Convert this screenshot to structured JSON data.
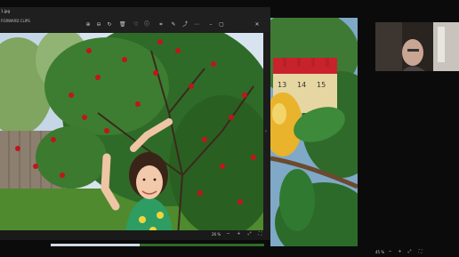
{
  "viewer_left": {
    "title": "1.jpg",
    "breadcrumb": "FORWARD CLIPS",
    "zoom": "26 %",
    "toolbar_icons": [
      "zoom-in-icon",
      "zoom-out-icon",
      "rotate-icon",
      "delete-icon",
      "favorite-icon",
      "info-icon",
      "crop-icon",
      "edit-icon",
      "share-icon",
      "more-icon",
      "minimize-icon",
      "maximize-icon",
      "close-icon"
    ]
  },
  "status_right": {
    "zoom": "45 %"
  },
  "colors": {
    "window_bg": "#1c1c1c",
    "leaf_green": "#2f6b28",
    "cherry_red": "#c0161a",
    "sky": "#d9e6f0"
  }
}
